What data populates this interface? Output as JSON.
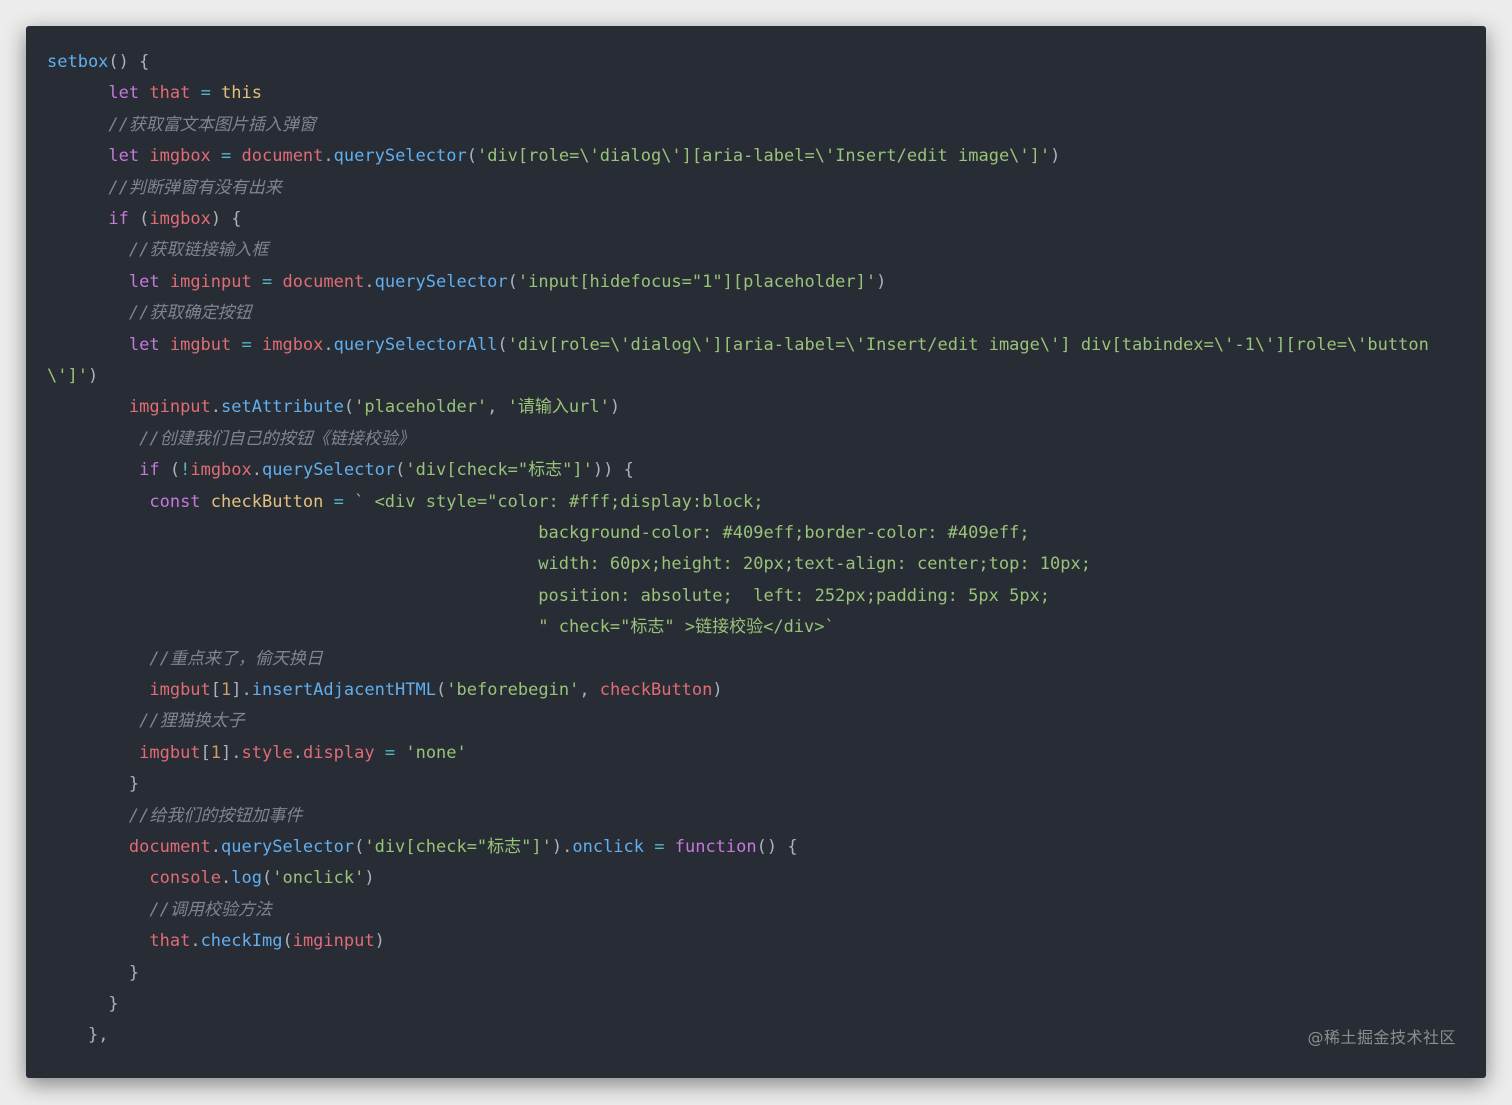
{
  "colors": {
    "background": "#282c34",
    "text": "#abb2bf",
    "keyword": "#c678dd",
    "variable": "#e06c75",
    "function": "#61afef",
    "string": "#98c379",
    "comment": "#7f848e",
    "number": "#d19a66",
    "operator": "#56b6c2",
    "this": "#e5c07b"
  },
  "code_lines": [
    {
      "indent": "",
      "tokens": [
        [
          "setbox",
          "function"
        ],
        [
          "() {",
          "text"
        ]
      ]
    },
    {
      "indent": "      ",
      "tokens": [
        [
          "let ",
          "keyword"
        ],
        [
          "that",
          "variable"
        ],
        [
          " = ",
          "operator"
        ],
        [
          "this",
          "this"
        ]
      ]
    },
    {
      "indent": "      ",
      "tokens": [
        [
          "//获取富文本图片插入弹窗",
          "comment"
        ]
      ]
    },
    {
      "indent": "      ",
      "tokens": [
        [
          "let ",
          "keyword"
        ],
        [
          "imgbox",
          "variable"
        ],
        [
          " = ",
          "operator"
        ],
        [
          "document",
          "variable"
        ],
        [
          ".",
          "text"
        ],
        [
          "querySelector",
          "function"
        ],
        [
          "(",
          "text"
        ],
        [
          "'div[role=\\'dialog\\'][aria-label=\\'Insert/edit image\\']'",
          "string"
        ],
        [
          ")",
          "text"
        ]
      ]
    },
    {
      "indent": "      ",
      "tokens": [
        [
          "//判断弹窗有没有出来",
          "comment"
        ]
      ]
    },
    {
      "indent": "      ",
      "tokens": [
        [
          "if",
          "keyword"
        ],
        [
          " (",
          "text"
        ],
        [
          "imgbox",
          "variable"
        ],
        [
          ") {",
          "text"
        ]
      ]
    },
    {
      "indent": "        ",
      "tokens": [
        [
          "//获取链接输入框",
          "comment"
        ]
      ]
    },
    {
      "indent": "        ",
      "tokens": [
        [
          "let ",
          "keyword"
        ],
        [
          "imginput",
          "variable"
        ],
        [
          " = ",
          "operator"
        ],
        [
          "document",
          "variable"
        ],
        [
          ".",
          "text"
        ],
        [
          "querySelector",
          "function"
        ],
        [
          "(",
          "text"
        ],
        [
          "'input[hidefocus=\"1\"][placeholder]'",
          "string"
        ],
        [
          ")",
          "text"
        ]
      ]
    },
    {
      "indent": "        ",
      "tokens": [
        [
          "//获取确定按钮",
          "comment"
        ]
      ]
    },
    {
      "indent": "        ",
      "tokens": [
        [
          "let ",
          "keyword"
        ],
        [
          "imgbut",
          "variable"
        ],
        [
          " = ",
          "operator"
        ],
        [
          "imgbox",
          "variable"
        ],
        [
          ".",
          "text"
        ],
        [
          "querySelectorAll",
          "function"
        ],
        [
          "(",
          "text"
        ],
        [
          "'div[role=\\'dialog\\'][aria-label=\\'Insert/edit image\\'] div[tabindex=\\'-1\\'][role=\\'button",
          "string"
        ]
      ]
    },
    {
      "indent": "",
      "tokens": [
        [
          "\\']'",
          "string"
        ],
        [
          ")",
          "text"
        ]
      ]
    },
    {
      "indent": "        ",
      "tokens": [
        [
          "imginput",
          "variable"
        ],
        [
          ".",
          "text"
        ],
        [
          "setAttribute",
          "function"
        ],
        [
          "(",
          "text"
        ],
        [
          "'placeholder'",
          "string"
        ],
        [
          ", ",
          "text"
        ],
        [
          "'请输入url'",
          "string"
        ],
        [
          ")",
          "text"
        ]
      ]
    },
    {
      "indent": "         ",
      "tokens": [
        [
          "//创建我们自己的按钮《链接校验》",
          "comment"
        ]
      ]
    },
    {
      "indent": "         ",
      "tokens": [
        [
          "if",
          "keyword"
        ],
        [
          " (",
          "text"
        ],
        [
          "!",
          "operator"
        ],
        [
          "imgbox",
          "variable"
        ],
        [
          ".",
          "text"
        ],
        [
          "querySelector",
          "function"
        ],
        [
          "(",
          "text"
        ],
        [
          "'div[check=\"标志\"]'",
          "string"
        ],
        [
          ")) {",
          "text"
        ]
      ]
    },
    {
      "indent": "          ",
      "tokens": [
        [
          "const ",
          "keyword"
        ],
        [
          "checkButton",
          "this"
        ],
        [
          " = ",
          "operator"
        ],
        [
          "` <div style=\"color: #fff;display:block;",
          "string"
        ]
      ]
    },
    {
      "indent": "                                                ",
      "tokens": [
        [
          "background-color: #409eff;border-color: #409eff;",
          "string"
        ]
      ]
    },
    {
      "indent": "                                                ",
      "tokens": [
        [
          "width: 60px;height: 20px;text-align: center;top: 10px;",
          "string"
        ]
      ]
    },
    {
      "indent": "                                                ",
      "tokens": [
        [
          "position: absolute;  left: 252px;padding: 5px 5px;",
          "string"
        ]
      ]
    },
    {
      "indent": "                                                ",
      "tokens": [
        [
          "\" check=\"标志\" >链接校验</div>`",
          "string"
        ]
      ]
    },
    {
      "indent": "          ",
      "tokens": [
        [
          "//重点来了，偷天换日",
          "comment"
        ]
      ]
    },
    {
      "indent": "          ",
      "tokens": [
        [
          "imgbut",
          "variable"
        ],
        [
          "[",
          "text"
        ],
        [
          "1",
          "number"
        ],
        [
          "].",
          "text"
        ],
        [
          "insertAdjacentHTML",
          "function"
        ],
        [
          "(",
          "text"
        ],
        [
          "'beforebegin'",
          "string"
        ],
        [
          ", ",
          "text"
        ],
        [
          "checkButton",
          "variable"
        ],
        [
          ")",
          "text"
        ]
      ]
    },
    {
      "indent": "         ",
      "tokens": [
        [
          "//狸猫换太子",
          "comment"
        ]
      ]
    },
    {
      "indent": "         ",
      "tokens": [
        [
          "imgbut",
          "variable"
        ],
        [
          "[",
          "text"
        ],
        [
          "1",
          "number"
        ],
        [
          "].",
          "text"
        ],
        [
          "style",
          "variable"
        ],
        [
          ".",
          "text"
        ],
        [
          "display",
          "variable"
        ],
        [
          " = ",
          "operator"
        ],
        [
          "'none'",
          "string"
        ]
      ]
    },
    {
      "indent": "        ",
      "tokens": [
        [
          "}",
          "text"
        ]
      ]
    },
    {
      "indent": "        ",
      "tokens": [
        [
          "//给我们的按钮加事件",
          "comment"
        ]
      ]
    },
    {
      "indent": "        ",
      "tokens": [
        [
          "document",
          "variable"
        ],
        [
          ".",
          "text"
        ],
        [
          "querySelector",
          "function"
        ],
        [
          "(",
          "text"
        ],
        [
          "'div[check=\"标志\"]'",
          "string"
        ],
        [
          ").",
          "text"
        ],
        [
          "onclick",
          "function"
        ],
        [
          " = ",
          "operator"
        ],
        [
          "function",
          "keyword"
        ],
        [
          "() {",
          "text"
        ]
      ]
    },
    {
      "indent": "          ",
      "tokens": [
        [
          "console",
          "variable"
        ],
        [
          ".",
          "text"
        ],
        [
          "log",
          "function"
        ],
        [
          "(",
          "text"
        ],
        [
          "'onclick'",
          "string"
        ],
        [
          ")",
          "text"
        ]
      ]
    },
    {
      "indent": "          ",
      "tokens": [
        [
          "//调用校验方法",
          "comment"
        ]
      ]
    },
    {
      "indent": "          ",
      "tokens": [
        [
          "that",
          "variable"
        ],
        [
          ".",
          "text"
        ],
        [
          "checkImg",
          "function"
        ],
        [
          "(",
          "text"
        ],
        [
          "imginput",
          "variable"
        ],
        [
          ")",
          "text"
        ]
      ]
    },
    {
      "indent": "        ",
      "tokens": [
        [
          "}",
          "text"
        ]
      ]
    },
    {
      "indent": "      ",
      "tokens": [
        [
          "}",
          "text"
        ]
      ]
    },
    {
      "indent": "    ",
      "tokens": [
        [
          "},",
          "text"
        ]
      ]
    }
  ],
  "watermark": "@稀土掘金技术社区"
}
